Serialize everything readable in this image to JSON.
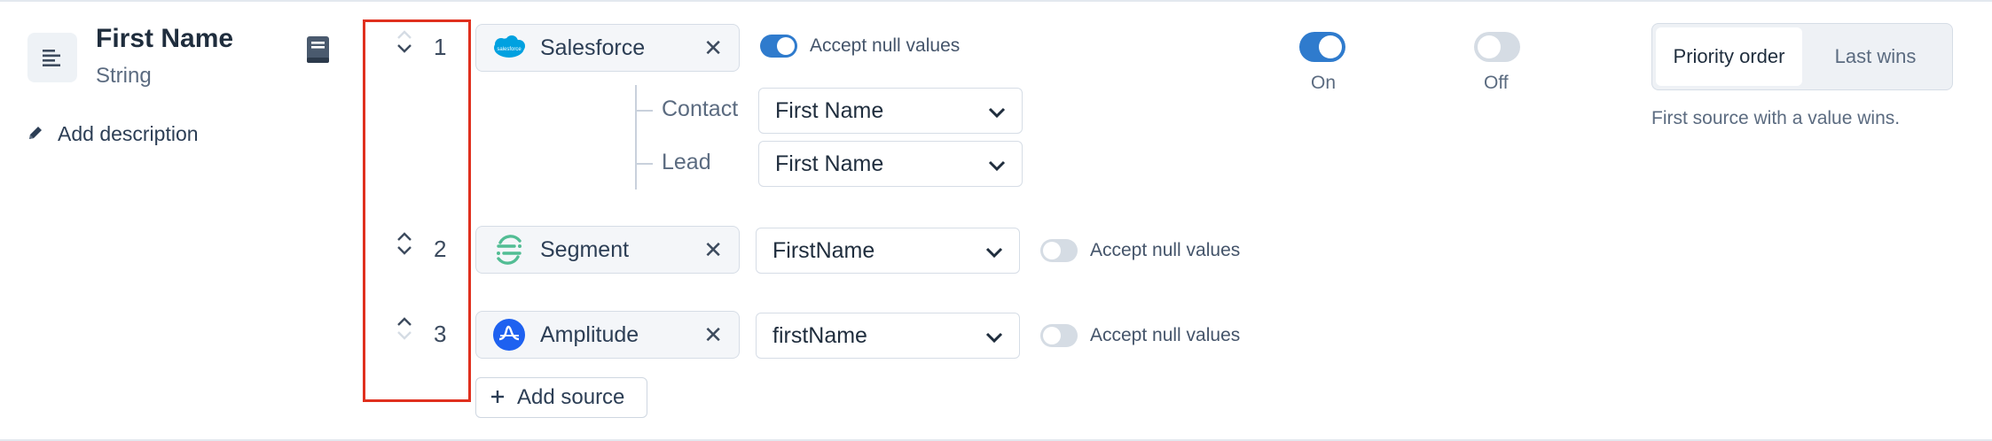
{
  "field": {
    "title": "First Name",
    "type": "String",
    "add_description": "Add description"
  },
  "sources": [
    {
      "order": "1",
      "name": "Salesforce",
      "logo_label": "salesforce",
      "accept_null_label": "Accept null values",
      "accept_null": true,
      "objects": [
        {
          "label": "Contact",
          "value": "First Name"
        },
        {
          "label": "Lead",
          "value": "First Name"
        }
      ]
    },
    {
      "order": "2",
      "name": "Segment",
      "mapping": "FirstName",
      "accept_null_label": "Accept null values",
      "accept_null": false
    },
    {
      "order": "3",
      "name": "Amplitude",
      "mapping": "firstName",
      "accept_null_label": "Accept null values",
      "accept_null": false
    }
  ],
  "add_source_label": "Add source",
  "state": {
    "on_label": "On",
    "off_label": "Off"
  },
  "strategy": {
    "options": [
      "Priority order",
      "Last wins"
    ],
    "selected": "Priority order",
    "description": "First source with a value wins."
  },
  "colors": {
    "accent": "#2f7bcd",
    "highlight": "#e0301e",
    "salesforce": "#00a1e0",
    "segment": "#52bd94",
    "amplitude": "#1e61f0"
  },
  "icons": {
    "field": "text-align-icon",
    "description": "pencil-icon",
    "docs": "book-icon",
    "close": "close-icon",
    "select": "chevron-down-icon",
    "add": "plus-icon"
  }
}
